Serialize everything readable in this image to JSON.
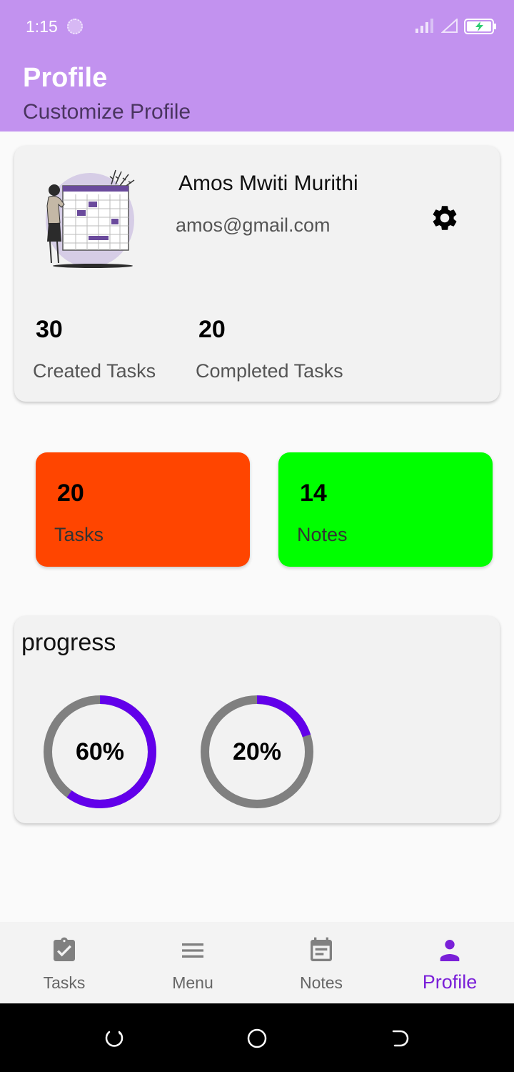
{
  "status_bar": {
    "time": "1:15"
  },
  "header": {
    "title": "Profile",
    "subtitle": "Customize Profile"
  },
  "profile": {
    "name": "Amos Mwiti Murithi",
    "email": "amos@gmail.com",
    "illustration_icon": "calendar-planner-illustration",
    "settings_icon": "gear-icon",
    "stats": [
      {
        "value": "30",
        "label": "Created Tasks"
      },
      {
        "value": "20",
        "label": "Completed Tasks"
      }
    ]
  },
  "tiles": [
    {
      "value": "20",
      "label": "Tasks",
      "color": "#ff4500"
    },
    {
      "value": "14",
      "label": "Notes",
      "color": "#00ff00"
    }
  ],
  "progress": {
    "title": "progress",
    "rings": [
      {
        "value": 60,
        "label": "60%"
      },
      {
        "value": 20,
        "label": "20%"
      }
    ],
    "track_color": "#808080",
    "fill_color": "#6200ea"
  },
  "bottom_nav": {
    "active": "Profile",
    "active_color": "#7a20d8",
    "items": [
      {
        "label": "Tasks",
        "icon": "clipboard-check-icon"
      },
      {
        "label": "Menu",
        "icon": "menu-icon"
      },
      {
        "label": "Notes",
        "icon": "calendar-note-icon"
      },
      {
        "label": "Profile",
        "icon": "person-icon"
      }
    ]
  },
  "colors": {
    "header_bg": "#c292ef",
    "card_bg": "#f2f2f2",
    "page_bg": "#fafafa"
  }
}
